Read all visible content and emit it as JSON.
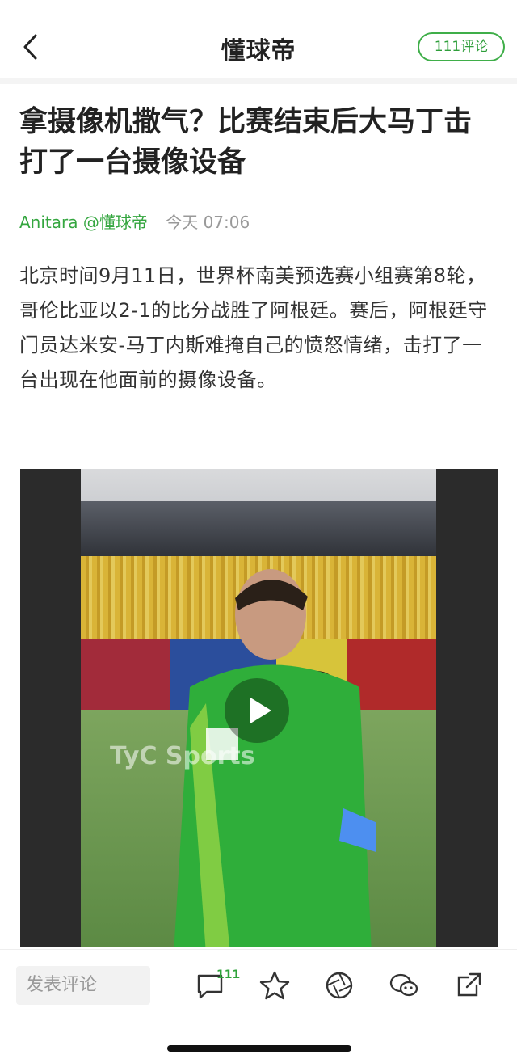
{
  "nav": {
    "back_icon": "chevron-left-icon",
    "brand": "懂球帝",
    "comment_pill": "111评论",
    "accent": "#3fae49"
  },
  "article": {
    "title": "拿摄像机撒气？比赛结束后大马丁击打了一台摄像设备",
    "author": "Anitara @懂球帝",
    "time": "今天 07:06",
    "body": "北京时间9月11日，世界杯南美预选赛小组赛第8轮，哥伦比亚以2-1的比分战胜了阿根廷。赛后，阿根廷守门员达米安-马丁内斯难掩自己的愤怒情绪，击打了一台出现在他面前的摄像设备。"
  },
  "video": {
    "watermark": "TyC Sports",
    "play_icon": "play-icon"
  },
  "bottom": {
    "comment_placeholder": "发表评论",
    "comment_count": "111",
    "icons": [
      "comment-icon",
      "star-icon",
      "aperture-icon",
      "wechat-icon",
      "share-icon"
    ]
  }
}
